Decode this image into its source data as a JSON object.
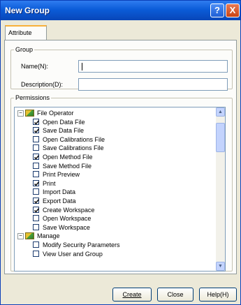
{
  "window": {
    "title": "New Group"
  },
  "titlebar_buttons": {
    "help": "?",
    "close": "X"
  },
  "tabs": [
    {
      "label": "Attribute"
    }
  ],
  "group": {
    "legend": "Group",
    "name_label": "Name(N):",
    "name_value": "",
    "description_label": "Description(D):",
    "description_value": ""
  },
  "permissions": {
    "legend": "Permissions",
    "categories": [
      {
        "label": "File Operator",
        "items": [
          {
            "label": "Open Data File",
            "checked": true
          },
          {
            "label": "Save Data File",
            "checked": true
          },
          {
            "label": "Open Calibrations File",
            "checked": false
          },
          {
            "label": "Save Calibrations File",
            "checked": false
          },
          {
            "label": "Open Method File",
            "checked": true
          },
          {
            "label": "Save Method File",
            "checked": false
          },
          {
            "label": "Print Preview",
            "checked": false
          },
          {
            "label": "Print",
            "checked": true
          },
          {
            "label": "Import Data",
            "checked": false
          },
          {
            "label": "Export Data",
            "checked": true
          },
          {
            "label": "Create Workspace",
            "checked": true
          },
          {
            "label": "Open Workspace",
            "checked": false
          },
          {
            "label": "Save Workspace",
            "checked": false
          }
        ]
      },
      {
        "label": "Manage",
        "items": [
          {
            "label": "Modify Security Parameters",
            "checked": false
          },
          {
            "label": "View User and Group",
            "checked": false
          }
        ]
      }
    ]
  },
  "buttons": {
    "create": "Create",
    "close": "Close",
    "help": "Help(H)"
  },
  "icons": {
    "expander": "minus-box-icon",
    "category": "folder-icon",
    "scroll_up": "arrow-up-icon",
    "scroll_down": "arrow-down-icon"
  }
}
